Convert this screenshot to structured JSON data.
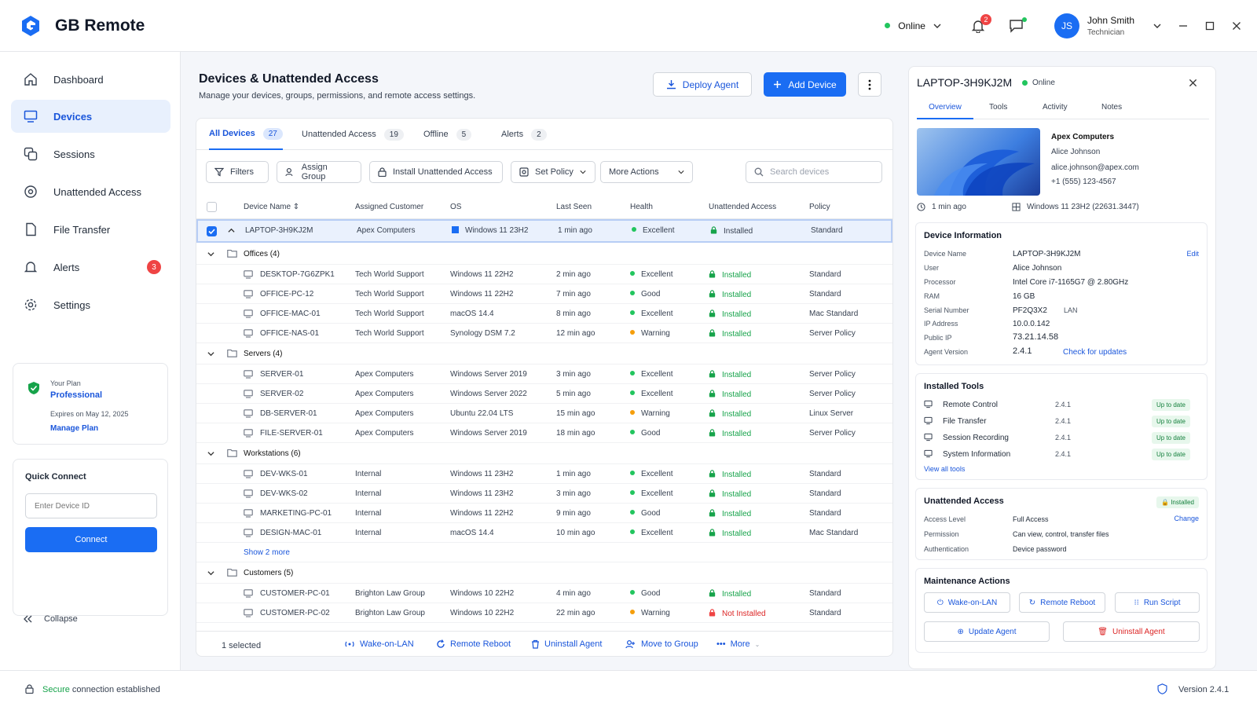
{
  "app": {
    "name": "GB Remote",
    "status": "Online",
    "notifications": "2",
    "user": {
      "initials": "JS",
      "name": "John Smith",
      "role": "Technician"
    }
  },
  "sidebar": {
    "items": [
      {
        "label": "Dashboard",
        "icon": "home-icon"
      },
      {
        "label": "Devices",
        "icon": "monitor-icon",
        "active": true
      },
      {
        "label": "Sessions",
        "icon": "sessions-icon"
      },
      {
        "label": "Unattended Access",
        "icon": "unattended-icon"
      },
      {
        "label": "File Transfer",
        "icon": "file-icon"
      },
      {
        "label": "Alerts",
        "icon": "bell-icon",
        "badge": "3"
      },
      {
        "label": "Settings",
        "icon": "gear-icon"
      }
    ],
    "plan": {
      "label": "Your Plan",
      "name": "Professional",
      "expires": "Expires on May 12, 2025",
      "manage": "Manage Plan"
    },
    "quick_connect": {
      "title": "Quick Connect",
      "placeholder": "Enter Device ID",
      "button": "Connect"
    },
    "collapse": "Collapse"
  },
  "main": {
    "title": "Devices & Unattended Access",
    "subtitle": "Manage your devices, groups, permissions, and remote access settings.",
    "deploy": "Deploy Agent",
    "add": "Add Device",
    "tabs": [
      {
        "label": "All Devices",
        "count": "27"
      },
      {
        "label": "Unattended Access",
        "count": "19"
      },
      {
        "label": "Offline",
        "count": "5"
      },
      {
        "label": "Alerts",
        "count": "2"
      }
    ],
    "toolbar": {
      "filters": "Filters",
      "assign": "Assign Group",
      "install": "Install Unattended Access",
      "policy": "Set Policy",
      "more": "More Actions",
      "search": "Search devices"
    },
    "columns": [
      "Device Name",
      "Assigned Customer",
      "OS",
      "Last Seen",
      "Health",
      "Unattended Access",
      "Policy"
    ],
    "selected_row": {
      "name": "LAPTOP-3H9KJ2M",
      "customer": "Apex Computers",
      "os": "Windows 11 23H2",
      "seen": "1 min ago",
      "health": "Excellent",
      "access": "Installed",
      "policy": "Standard"
    },
    "groups": [
      {
        "label": "Offices (4)",
        "rows": [
          {
            "name": "DESKTOP-7G6ZPK1",
            "customer": "Tech World Support",
            "os": "Windows 11 22H2",
            "seen": "2 min ago",
            "health": "Excellent",
            "access": "Installed",
            "policy": "Standard"
          },
          {
            "name": "OFFICE-PC-12",
            "customer": "Tech World Support",
            "os": "Windows 11 22H2",
            "seen": "7 min ago",
            "health": "Good",
            "access": "Installed",
            "policy": "Standard"
          },
          {
            "name": "OFFICE-MAC-01",
            "customer": "Tech World Support",
            "os": "macOS 14.4",
            "seen": "8 min ago",
            "health": "Excellent",
            "access": "Installed",
            "policy": "Mac Standard"
          },
          {
            "name": "OFFICE-NAS-01",
            "customer": "Tech World Support",
            "os": "Synology DSM 7.2",
            "seen": "12 min ago",
            "health": "Warning",
            "access": "Installed",
            "policy": "Server Policy"
          }
        ]
      },
      {
        "label": "Servers (4)",
        "rows": [
          {
            "name": "SERVER-01",
            "customer": "Apex Computers",
            "os": "Windows Server 2019",
            "seen": "3 min ago",
            "health": "Excellent",
            "access": "Installed",
            "policy": "Server Policy"
          },
          {
            "name": "SERVER-02",
            "customer": "Apex Computers",
            "os": "Windows Server 2022",
            "seen": "5 min ago",
            "health": "Excellent",
            "access": "Installed",
            "policy": "Server Policy"
          },
          {
            "name": "DB-SERVER-01",
            "customer": "Apex Computers",
            "os": "Ubuntu 22.04 LTS",
            "seen": "15 min ago",
            "health": "Warning",
            "access": "Installed",
            "policy": "Linux Server"
          },
          {
            "name": "FILE-SERVER-01",
            "customer": "Apex Computers",
            "os": "Windows Server 2019",
            "seen": "18 min ago",
            "health": "Good",
            "access": "Installed",
            "policy": "Server Policy"
          }
        ]
      },
      {
        "label": "Workstations (6)",
        "rows": [
          {
            "name": "DEV-WKS-01",
            "customer": "Internal",
            "os": "Windows 11 23H2",
            "seen": "1 min ago",
            "health": "Excellent",
            "access": "Installed",
            "policy": "Standard"
          },
          {
            "name": "DEV-WKS-02",
            "customer": "Internal",
            "os": "Windows 11 23H2",
            "seen": "3 min ago",
            "health": "Excellent",
            "access": "Installed",
            "policy": "Standard"
          },
          {
            "name": "MARKETING-PC-01",
            "customer": "Internal",
            "os": "Windows 11 22H2",
            "seen": "9 min ago",
            "health": "Good",
            "access": "Installed",
            "policy": "Standard"
          },
          {
            "name": "DESIGN-MAC-01",
            "customer": "Internal",
            "os": "macOS 14.4",
            "seen": "10 min ago",
            "health": "Excellent",
            "access": "Installed",
            "policy": "Mac Standard"
          }
        ],
        "more": "Show 2 more"
      },
      {
        "label": "Customers (5)",
        "rows": [
          {
            "name": "CUSTOMER-PC-01",
            "customer": "Brighton Law Group",
            "os": "Windows 10 22H2",
            "seen": "4 min ago",
            "health": "Good",
            "access": "Installed",
            "policy": "Standard"
          },
          {
            "name": "CUSTOMER-PC-02",
            "customer": "Brighton Law Group",
            "os": "Windows 10 22H2",
            "seen": "22 min ago",
            "health": "Warning",
            "access": "Not Installed",
            "policy": "Standard"
          }
        ]
      }
    ],
    "footer": {
      "selected": "1 selected",
      "wol": "Wake-on-LAN",
      "reboot": "Remote Reboot",
      "uninstall": "Uninstall Agent",
      "move": "Move to Group",
      "more": "More"
    }
  },
  "panel": {
    "device": "LAPTOP-3H9KJ2M",
    "status": "Online",
    "tabs": [
      "Overview",
      "Tools",
      "Activity",
      "Notes"
    ],
    "owner": {
      "company": "Apex Computers",
      "name": "Alice Johnson",
      "email": "alice.johnson@apex.com",
      "phone": "+1 (555) 123-4567"
    },
    "seen": "1 min ago",
    "os": "Windows 11 23H2 (22631.3447)",
    "info": {
      "title": "Device Information",
      "edit": "Edit",
      "rows": [
        {
          "k": "Device Name",
          "v": "LAPTOP-3H9KJ2M"
        },
        {
          "k": "User",
          "v": "Alice Johnson"
        },
        {
          "k": "Processor",
          "v": "Intel Core i7-1165G7 @ 2.80GHz"
        },
        {
          "k": "RAM",
          "v": "16 GB"
        },
        {
          "k": "Serial Number",
          "v": "PF2Q3X2"
        },
        {
          "k": "IP Address",
          "v": "10.0.0.142"
        },
        {
          "k": "Public IP",
          "v": "73.21.14.58"
        },
        {
          "k": "Agent Version",
          "v": "2.4.1"
        }
      ],
      "lan": "LAN",
      "check": "Check for updates"
    },
    "tools": {
      "title": "Installed Tools",
      "rows": [
        {
          "name": "Remote Control",
          "ver": "2.4.1",
          "status": "Up to date"
        },
        {
          "name": "File Transfer",
          "ver": "2.4.1",
          "status": "Up to date"
        },
        {
          "name": "Session Recording",
          "ver": "2.4.1",
          "status": "Up to date"
        },
        {
          "name": "System Information",
          "ver": "2.4.1",
          "status": "Up to date"
        }
      ],
      "view_all": "View all tools"
    },
    "unattended": {
      "title": "Unattended Access",
      "badge": "Installed",
      "change": "Change",
      "rows": [
        {
          "k": "Access Level",
          "v": "Full Access"
        },
        {
          "k": "Permission",
          "v": "Can view, control, transfer files"
        },
        {
          "k": "Authentication",
          "v": "Device password"
        }
      ]
    },
    "maint": {
      "title": "Maintenance Actions",
      "wol": "Wake-on-LAN",
      "reboot": "Remote Reboot",
      "script": "Run Script",
      "update": "Update Agent",
      "uninstall": "Uninstall Agent"
    }
  },
  "statusbar": {
    "secure": "Secure",
    "conn": "connection established",
    "version": "Version 2.4.1"
  },
  "colors": {
    "accent": "#1a6df3",
    "ok": "#16a34a",
    "warn": "#f59e0b",
    "danger": "#ef4444"
  }
}
